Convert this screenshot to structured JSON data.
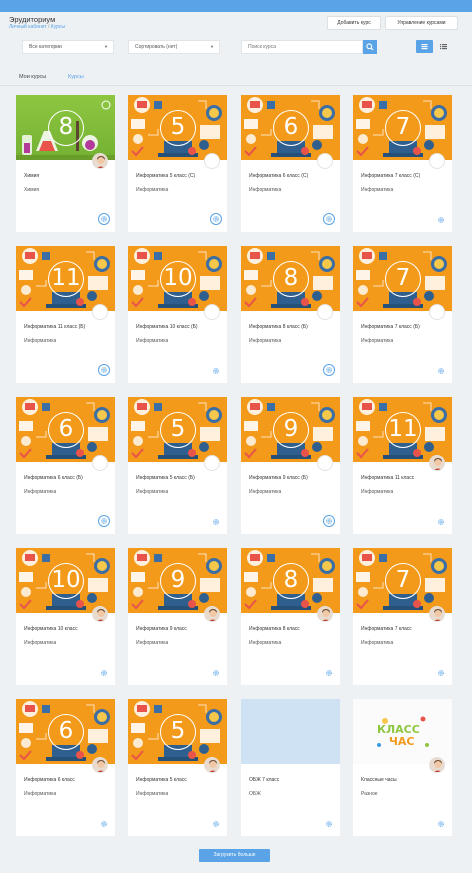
{
  "header": {
    "title": "Эрудиториум",
    "breadcrumb": {
      "home": "Личный кабинет",
      "separator": "/",
      "current": "Курсы"
    },
    "add_course_label": "Добавить курс",
    "manage_courses_label": "Управление курсами"
  },
  "filters": {
    "category": "Все категории",
    "sort": "Сортировать (нет)",
    "search_placeholder": "Поиск курса"
  },
  "tabs": [
    {
      "label": "Мои курсы",
      "active": false
    },
    {
      "label": "Курсы",
      "active": true
    }
  ],
  "colors": {
    "accent": "#5aa3e6",
    "orange": "#f39a1b",
    "chem": "#8ec640"
  },
  "courses": [
    {
      "title": "Химия",
      "subject": "Химия",
      "grade": "8",
      "thumb": "chemistry",
      "avatar": "face",
      "gear_icon": "gear-icon"
    },
    {
      "title": "Информатика 5 класс (С)",
      "subject": "Информатика",
      "grade": "5",
      "thumb": "informatics",
      "avatar": "blank",
      "gear_icon": "gear-icon"
    },
    {
      "title": "Информатика 6 класс (С)",
      "subject": "Информатика",
      "grade": "6",
      "thumb": "informatics",
      "avatar": "blank",
      "gear_icon": "gear-icon"
    },
    {
      "title": "Информатика 7 класс (С)",
      "subject": "Информатика",
      "grade": "7",
      "thumb": "informatics",
      "avatar": "blank",
      "gear_icon": "gear-icon"
    },
    {
      "title": "Информатика 11 класс (Б)",
      "subject": "Информатика",
      "grade": "11",
      "thumb": "informatics",
      "avatar": "blank",
      "gear_icon": "gear-icon"
    },
    {
      "title": "Информатика 10 класс (Б)",
      "subject": "Информатика",
      "grade": "10",
      "thumb": "informatics",
      "avatar": "blank",
      "gear_icon": "gear-icon"
    },
    {
      "title": "Информатика 8 класс (Б)",
      "subject": "Информатика",
      "grade": "8",
      "thumb": "informatics",
      "avatar": "blank",
      "gear_icon": "gear-icon"
    },
    {
      "title": "Информатика 7 класс (Б)",
      "subject": "Информатика",
      "grade": "7",
      "thumb": "informatics",
      "avatar": "blank",
      "gear_icon": "gear-icon"
    },
    {
      "title": "Информатика 6 класс (Б)",
      "subject": "Информатика",
      "grade": "6",
      "thumb": "informatics",
      "avatar": "blank",
      "gear_icon": "gear-icon"
    },
    {
      "title": "Информатика 5 класс (Б)",
      "subject": "Информатика",
      "grade": "5",
      "thumb": "informatics",
      "avatar": "blank",
      "gear_icon": "gear-icon"
    },
    {
      "title": "Информатика 9 класс (Б)",
      "subject": "Информатика",
      "grade": "9",
      "thumb": "informatics",
      "avatar": "blank",
      "gear_icon": "gear-icon"
    },
    {
      "title": "Информатика 11 класс",
      "subject": "Информатика",
      "grade": "11",
      "thumb": "informatics",
      "avatar": "face",
      "gear_icon": "gear-icon"
    },
    {
      "title": "Информатика 10 класс",
      "subject": "Информатика",
      "grade": "10",
      "thumb": "informatics",
      "avatar": "face",
      "gear_icon": "gear-icon"
    },
    {
      "title": "Информатика 9 класс",
      "subject": "Информатика",
      "grade": "9",
      "thumb": "informatics",
      "avatar": "face",
      "gear_icon": "gear-icon"
    },
    {
      "title": "Информатика 8 класс",
      "subject": "Информатика",
      "grade": "8",
      "thumb": "informatics",
      "avatar": "face",
      "gear_icon": "gear-icon"
    },
    {
      "title": "Информатика 7 класс",
      "subject": "Информатика",
      "grade": "7",
      "thumb": "informatics",
      "avatar": "face",
      "gear_icon": "gear-icon"
    },
    {
      "title": "Информатика 6 класс",
      "subject": "Информатика",
      "grade": "6",
      "thumb": "informatics",
      "avatar": "face",
      "gear_icon": "gear-icon"
    },
    {
      "title": "Информатика 5 класс",
      "subject": "Информатика",
      "grade": "5",
      "thumb": "informatics",
      "avatar": "face",
      "gear_icon": "gear-icon"
    },
    {
      "title": "ОБЖ 7 класс",
      "subject": "ОБЖ",
      "grade": "",
      "thumb": "empty",
      "avatar": "none",
      "gear_icon": "gear-icon"
    },
    {
      "title": "Классные часы",
      "subject": "Разное",
      "grade": "",
      "thumb": "klass-chas-logo",
      "avatar": "face",
      "gear_icon": "gear-icon"
    }
  ],
  "load_more_label": "Загрузить больше"
}
